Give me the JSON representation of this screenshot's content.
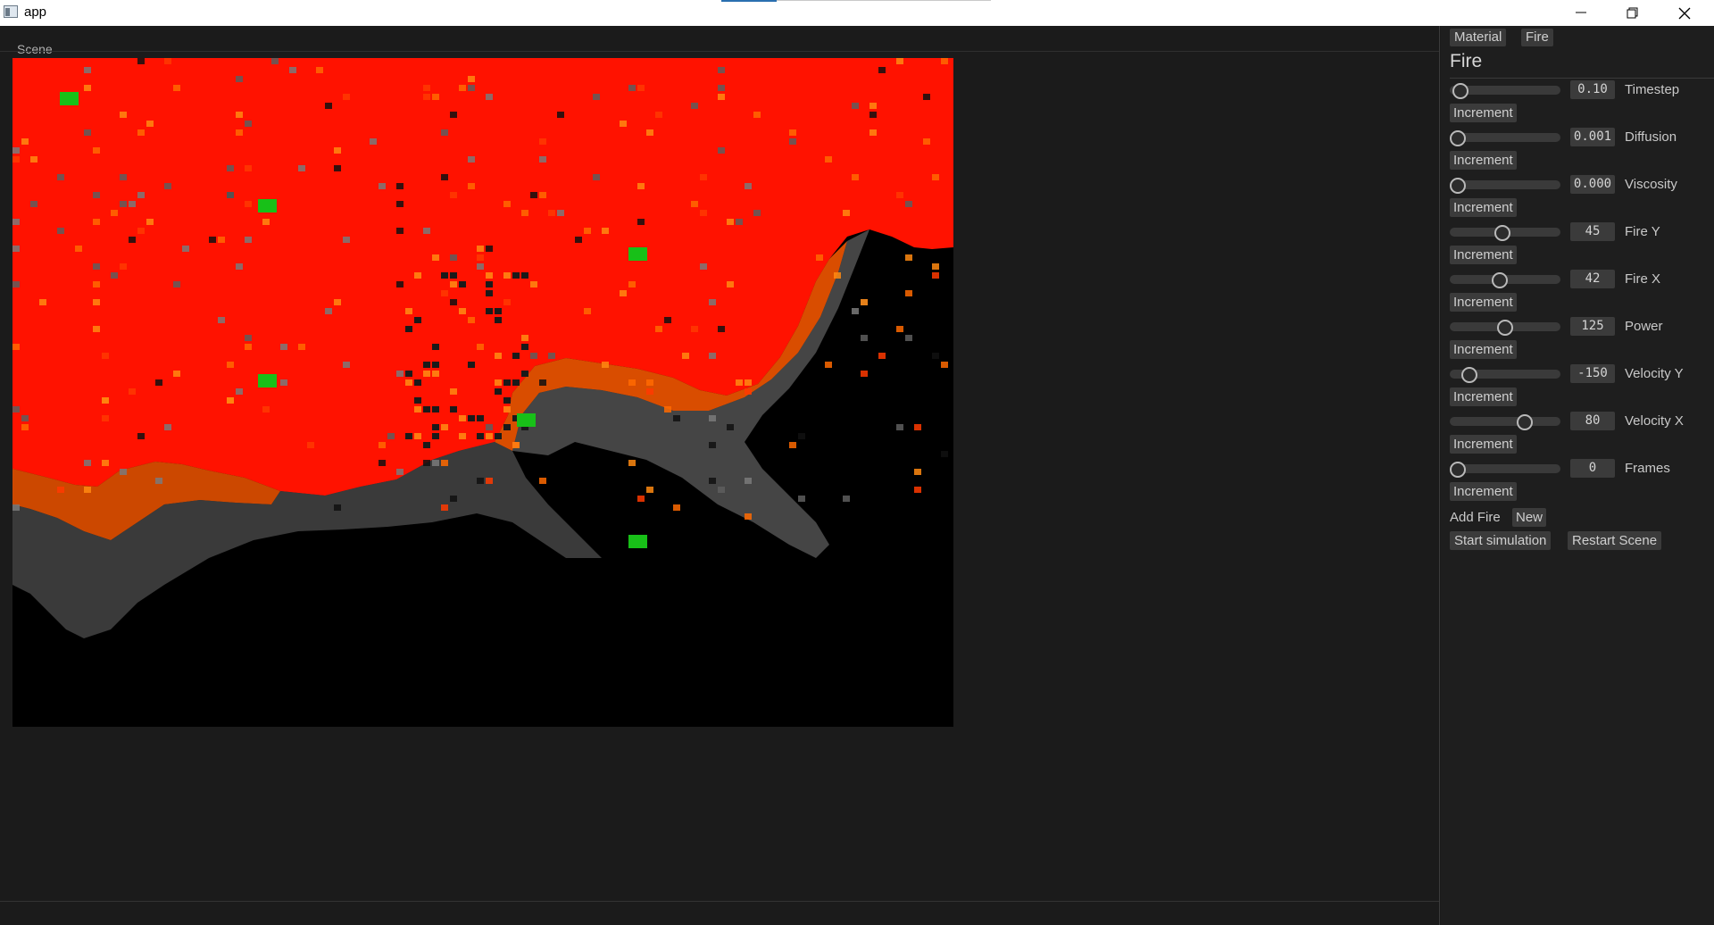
{
  "window": {
    "title": "app",
    "controls": [
      "minimize-icon",
      "maximize-icon",
      "close-icon"
    ]
  },
  "scene": {
    "label": "Scene"
  },
  "panel": {
    "tabs": [
      "Material",
      "Fire"
    ],
    "heading": "Fire",
    "params": [
      {
        "label": "Timestep",
        "value": "0.10",
        "increment": "Increment"
      },
      {
        "label": "Diffusion",
        "value": "0.001",
        "increment": "Increment"
      },
      {
        "label": "Viscosity",
        "value": "0.000",
        "increment": "Increment"
      },
      {
        "label": "Fire Y",
        "value": "45",
        "increment": "Increment"
      },
      {
        "label": "Fire X",
        "value": "42",
        "increment": "Increment"
      },
      {
        "label": "Power",
        "value": "125",
        "increment": "Increment"
      },
      {
        "label": "Velocity Y",
        "value": "-150",
        "increment": "Increment"
      },
      {
        "label": "Velocity X",
        "value": "80",
        "increment": "Increment"
      },
      {
        "label": "Frames",
        "value": "0",
        "increment": "Increment"
      }
    ],
    "add_fire_label": "Add Fire",
    "new_label": "New",
    "start_label": "Start simulation",
    "restart_label": "Restart Scene"
  },
  "colors": {
    "fire": "#ff1200",
    "ember": "#ff6a00",
    "source_marker": "#18c018"
  }
}
